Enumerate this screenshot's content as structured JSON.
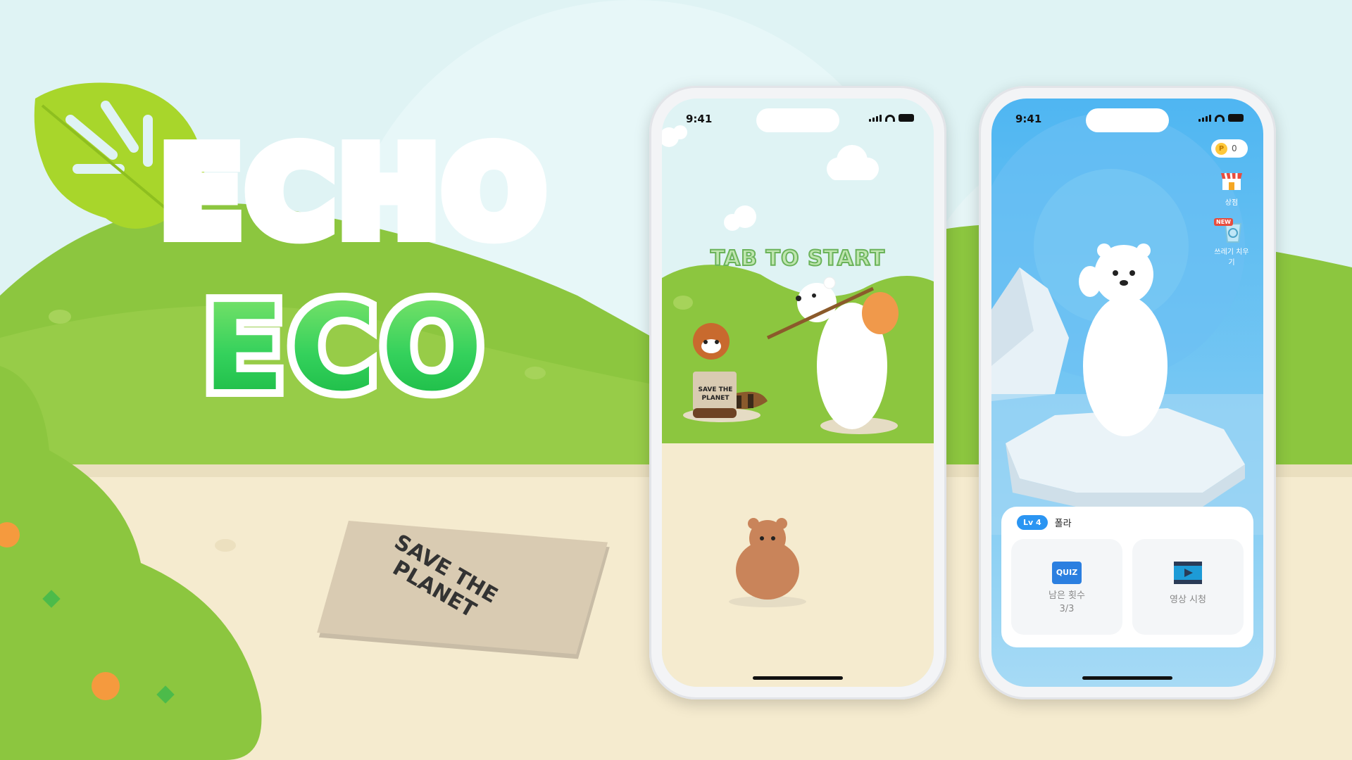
{
  "title": {
    "line1": "ECHO",
    "line2": "ECO"
  },
  "scene": {
    "sign_text": "SAVE THE PLANET"
  },
  "phone_start": {
    "status_time": "9:41",
    "prompt": "TAB TO START",
    "panda_sign": "SAVE THE PLANET"
  },
  "phone_home": {
    "status_time": "9:41",
    "coin_icon": "P",
    "coin_balance": "0",
    "shop_label": "상점",
    "cleanup_new_badge": "NEW",
    "cleanup_label": "쓰레기 치우기",
    "level_badge": "Lv 4",
    "pet_name": "폴라",
    "quiz_icon_text": "QUIZ",
    "quiz_label": "남은 횟수",
    "quiz_count": "3/3",
    "video_label": "영상 시청"
  },
  "colors": {
    "sky": "#dff3f4",
    "hill_green": "#8cc63f",
    "sand": "#f5ebcf",
    "title_orange": "#ff9a18",
    "title_green": "#34d15c",
    "accent_blue": "#2b95f2"
  },
  "icons": [
    "leaf-icon",
    "signal-icon",
    "wifi-icon",
    "battery-icon",
    "coin-icon",
    "shop-icon",
    "recycle-icon",
    "quiz-icon",
    "video-icon"
  ]
}
